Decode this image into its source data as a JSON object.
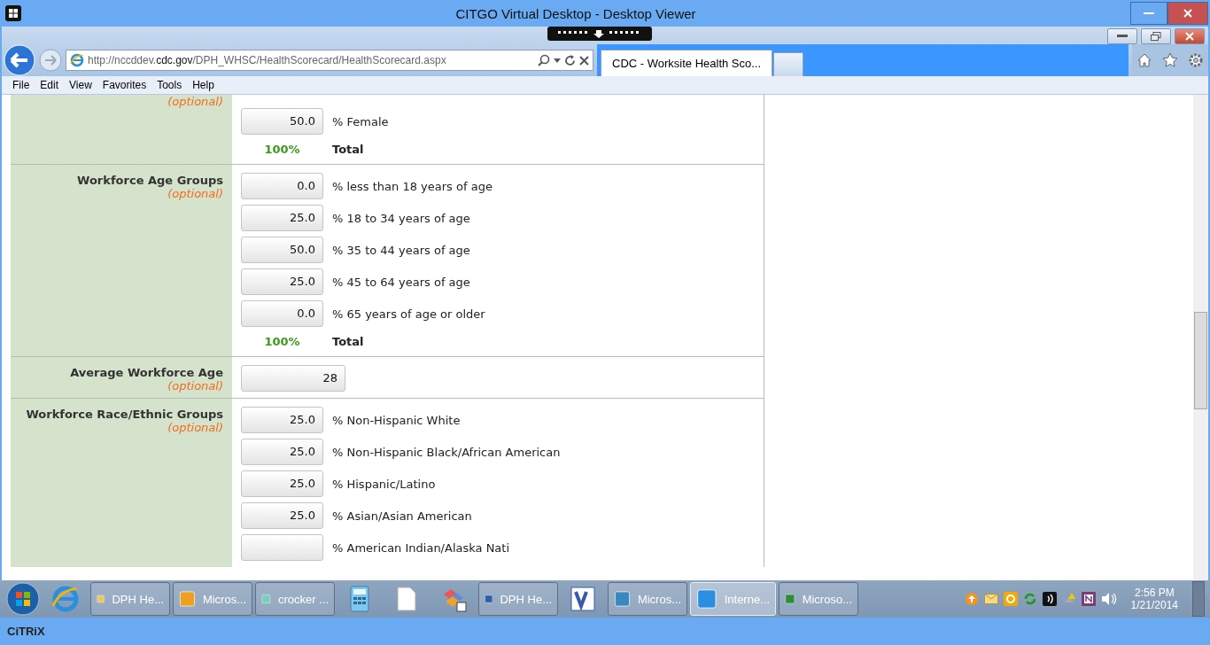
{
  "window": {
    "title": "CITGO Virtual Desktop - Desktop Viewer"
  },
  "browser": {
    "address": "http://nccddev.**cdc.gov**/DPH_WHSC/HealthScorecard/HealthScorecard.aspx",
    "tabs": [
      {
        "label": "CDC - Worksite Health Sco...",
        "selected": true
      }
    ],
    "menu": [
      "File",
      "Edit",
      "View",
      "Favorites",
      "Tools",
      "Help"
    ]
  },
  "sections": [
    {
      "optional": "(optional)",
      "rows": [
        {
          "kind": "input",
          "value": "50.0",
          "label": "% Female"
        },
        {
          "kind": "total",
          "value": "100%",
          "label": "Total"
        }
      ]
    },
    {
      "label": "Workforce Age Groups",
      "optional": "(optional)",
      "rows": [
        {
          "kind": "input",
          "value": "0.0",
          "label": "% less than 18 years of age"
        },
        {
          "kind": "input",
          "value": "25.0",
          "label": "% 18 to 34 years of age"
        },
        {
          "kind": "input",
          "value": "50.0",
          "label": "% 35 to 44 years of age"
        },
        {
          "kind": "input",
          "value": "25.0",
          "label": "% 45 to 64 years of age"
        },
        {
          "kind": "input",
          "value": "0.0",
          "label": "% 65 years of age or older"
        },
        {
          "kind": "total",
          "value": "100%",
          "label": "Total"
        }
      ]
    },
    {
      "label": "Average Workforce Age",
      "optional": "(optional)",
      "rows": [
        {
          "kind": "wide",
          "value": "28"
        }
      ]
    },
    {
      "label": "Workforce Race/Ethnic Groups",
      "optional": "(optional)",
      "rows": [
        {
          "kind": "input",
          "value": "25.0",
          "label": "% Non-Hispanic White"
        },
        {
          "kind": "input",
          "value": "25.0",
          "label": "% Non-Hispanic Black/African American"
        },
        {
          "kind": "input",
          "value": "25.0",
          "label": "% Hispanic/Latino"
        },
        {
          "kind": "input",
          "value": "25.0",
          "label": "% Asian/Asian American"
        },
        {
          "kind": "input",
          "value": "",
          "label": "% American Indian/Alaska Nati"
        }
      ]
    }
  ],
  "taskbar": {
    "items": [
      {
        "kind": "pinned",
        "selected": false
      },
      {
        "kind": "button",
        "label": "DPH He...",
        "selected": false
      },
      {
        "kind": "button",
        "label": "Micros...",
        "selected": false
      },
      {
        "kind": "button",
        "label": "crocker ...",
        "selected": false
      },
      {
        "kind": "pinned",
        "selected": false
      },
      {
        "kind": "pinned",
        "selected": false
      },
      {
        "kind": "pinned",
        "selected": false
      },
      {
        "kind": "button",
        "label": "DPH He...",
        "selected": false
      },
      {
        "kind": "pinned",
        "selected": false
      },
      {
        "kind": "button",
        "label": "Micros...",
        "selected": false
      },
      {
        "kind": "button",
        "label": "Interne...",
        "selected": true
      },
      {
        "kind": "button",
        "label": "Microso...",
        "selected": false
      }
    ],
    "time": "2:56 PM",
    "date": "1/21/2014"
  },
  "citrix": {
    "logo": "CiTRiX"
  }
}
